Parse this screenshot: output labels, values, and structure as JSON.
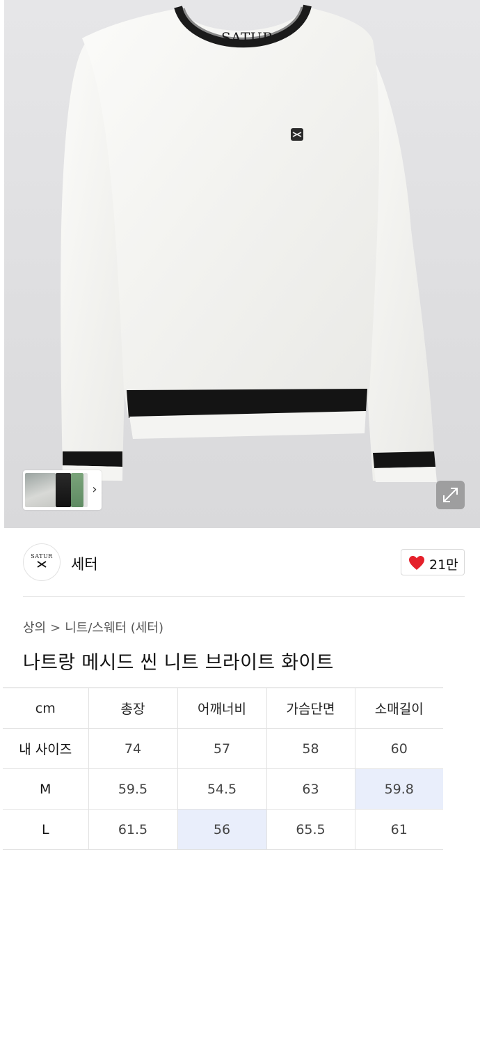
{
  "product_image": {
    "garment_brand_label": "SATUR",
    "thumbnails": [
      "model-white-thumb",
      "black-knit-thumb",
      "green-knit-thumb"
    ],
    "thumb_next_icon": "chevron-right-icon",
    "expand_icon": "expand-icon"
  },
  "brand": {
    "logo_text": "SATUR",
    "name": "세터",
    "like_icon": "heart-icon",
    "like_color": "#e5202a",
    "like_count": "21만"
  },
  "breadcrumb": {
    "level1": "상의",
    "separator": ">",
    "level2": "니트/스웨터 (세터)"
  },
  "product_title": "나트랑 메시드 씬 니트 브라이트 화이트",
  "size_table": {
    "unit": "cm",
    "columns": [
      "총장",
      "어깨너비",
      "가슴단면",
      "소매길이"
    ],
    "rows": [
      {
        "label": "내 사이즈",
        "values": [
          "74",
          "57",
          "58",
          "60"
        ]
      },
      {
        "label": "M",
        "values": [
          "59.5",
          "54.5",
          "63",
          "59.8"
        ]
      },
      {
        "label": "L",
        "values": [
          "61.5",
          "56",
          "65.5",
          "61"
        ]
      }
    ],
    "highlight_color": "#e9eefb"
  }
}
